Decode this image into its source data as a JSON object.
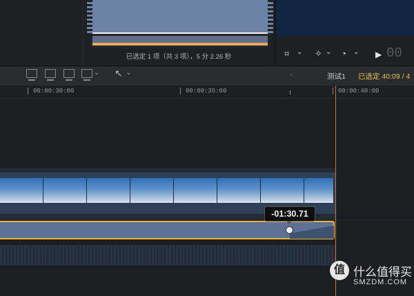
{
  "browser": {
    "selection_info": "已选定 1 项（共 3 项），5 分 2.26 秒"
  },
  "viewer": {
    "crop_icon": "⌗",
    "enhance_icon": "✧",
    "speed_icon": "◔",
    "chevron": "⌄",
    "play_icon": "▶",
    "timecode": "00"
  },
  "toolbar": {
    "back_icon": "‹",
    "select_tool_icon": "↖",
    "project_name": "测试1",
    "selected_duration": "已选定 40:09 / 4"
  },
  "timeline": {
    "ruler": [
      "00:00:30:00",
      "00:00:35:00",
      "00:00:40:00"
    ],
    "fade_tooltip": "-01:30.71"
  },
  "watermark": {
    "badge": "值",
    "text": "什么值得买",
    "sub": "SMZDM.COM"
  }
}
